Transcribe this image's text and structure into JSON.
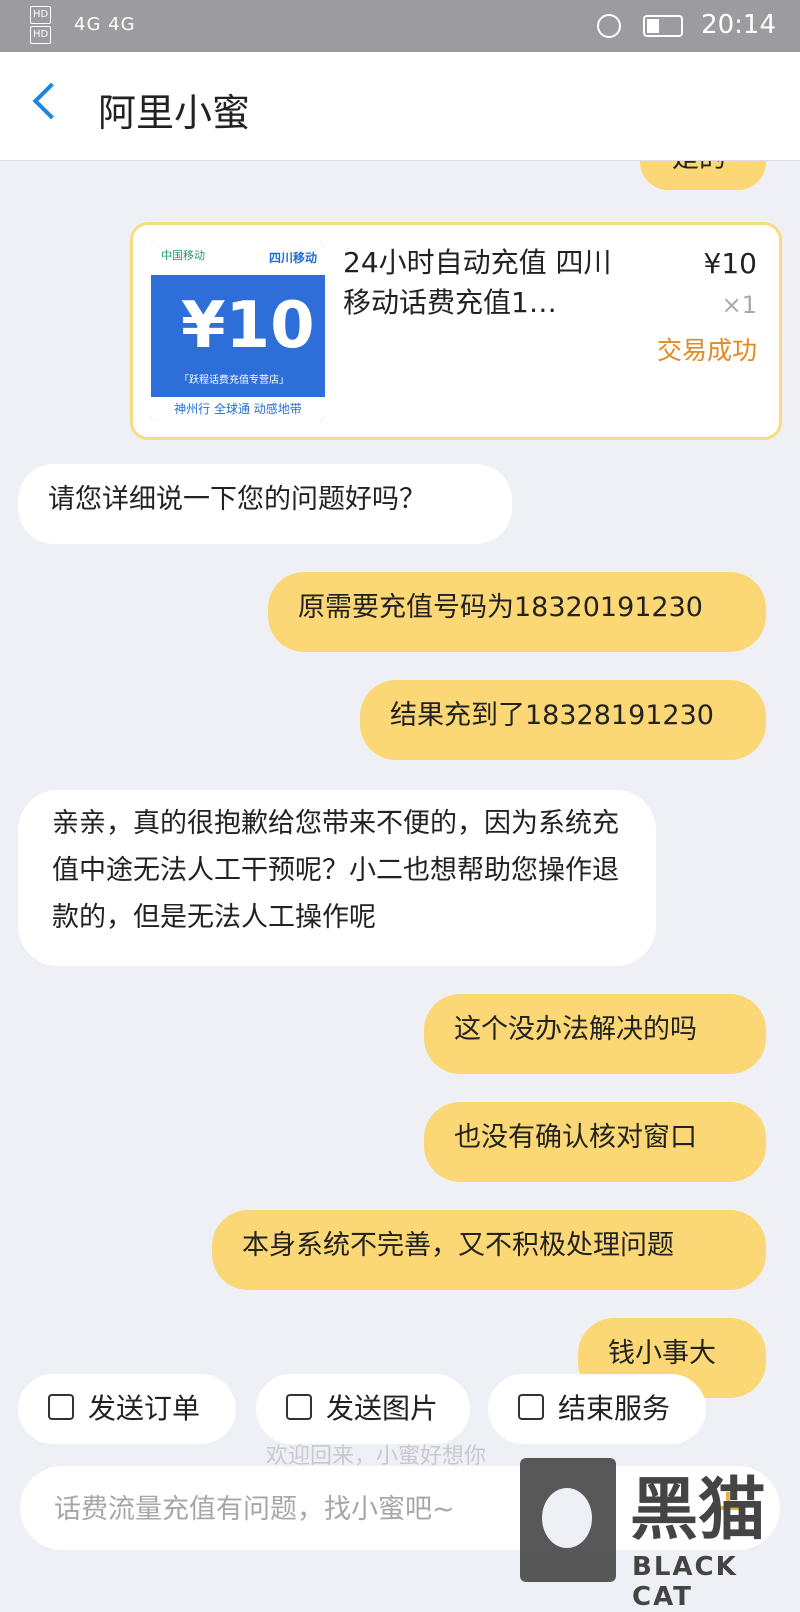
{
  "status_bar": {
    "hd1": "HD",
    "hd2": "HD",
    "network": "4G 4G",
    "time": "20:14"
  },
  "header": {
    "title": "阿里小蜜"
  },
  "messages": {
    "partial_top": "是的",
    "bot_ask": "请您详细说一下您的问题好吗？",
    "me_1": "原需要充值号码为18320191230",
    "me_2": "结果充到了18328191230",
    "bot_reply": "亲亲，真的很抱歉给您带来不便的，因为系统充值中途无法人工干预呢？小二也想帮助您操作退款的，但是无法人工操作呢",
    "me_3": "这个没办法解决的吗",
    "me_4": "也没有确认核对窗口",
    "me_5": "本身系统不完善，又不积极处理问题",
    "me_6": "钱小事大"
  },
  "order_card": {
    "title": "24小时自动充值 四川移动话费充值1…",
    "price": "¥10",
    "quantity": "×1",
    "status": "交易成功",
    "thumb_brand": "中国移动",
    "thumb_region": "四川移动",
    "thumb_price": "¥10",
    "thumb_shop": "「跃程话费充值专营店」",
    "thumb_slogan": "神州行 全球通 动感地带"
  },
  "quick_actions": {
    "send_order": "发送订单",
    "send_image": "发送图片",
    "end_service": "结束服务"
  },
  "welcome_text": "欢迎回来，小蜜好想你",
  "input": {
    "placeholder": "话费流量充值有问题，找小蜜吧~"
  },
  "watermark": {
    "cn": "黑猫",
    "en": "BLACK CAT"
  }
}
